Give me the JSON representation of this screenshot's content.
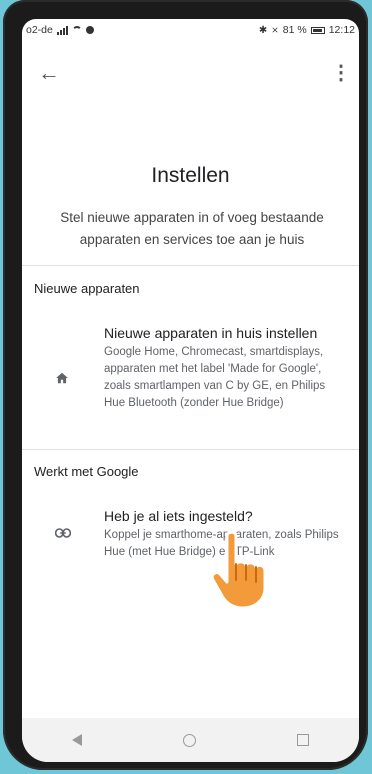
{
  "status": {
    "carrier": "o2-de",
    "right": "81 %",
    "time": "12:12"
  },
  "title": "Instellen",
  "subtitle": "Stel nieuwe apparaten in of voeg bestaande apparaten en services toe aan je huis",
  "sections": [
    {
      "heading": "Nieuwe apparaten",
      "item": {
        "icon": "home-icon",
        "title": "Nieuwe apparaten in huis instellen",
        "desc": "Google Home, Chromecast, smartdisplays, apparaten met het label 'Made for Google', zoals smartlampen van C by GE, en Philips Hue Bluetooth (zonder Hue Bridge)"
      }
    },
    {
      "heading": "Werkt met Google",
      "item": {
        "icon": "link-icon",
        "title": "Heb je al iets ingesteld?",
        "desc": "Koppel je smarthome-apparaten, zoals Philips Hue (met Hue Bridge) en TP-Link"
      }
    }
  ],
  "colors": {
    "background": "#6fc6d6",
    "hand": "#f39a3a"
  }
}
